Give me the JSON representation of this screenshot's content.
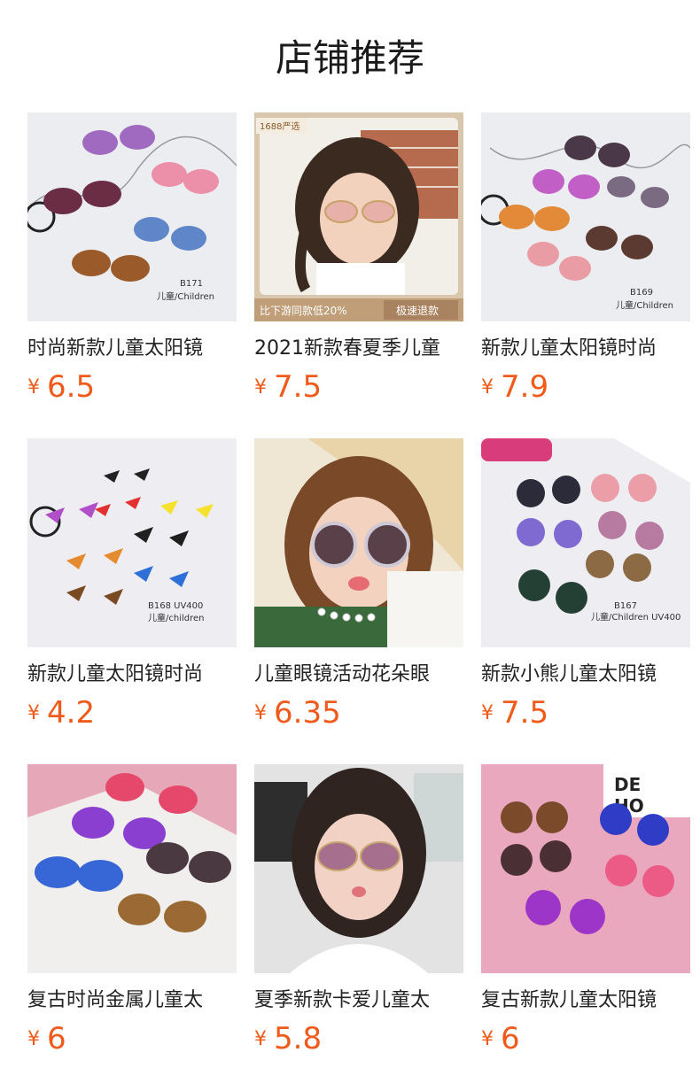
{
  "title": "店铺推荐",
  "currency": "¥",
  "products": [
    {
      "name": "时尚新款儿童太阳镜",
      "price": "6.5",
      "image_label": "B171",
      "image_sub": "儿童/Children",
      "bg": "#ecedf0"
    },
    {
      "name": "2021新款春夏季儿童",
      "price": "7.5",
      "badge_top": "1688严选",
      "banner_left": "比下游同款低20%",
      "banner_right": "极速退款",
      "bg": "#d9c7ad"
    },
    {
      "name": "新款儿童太阳镜时尚",
      "price": "7.9",
      "image_label": "B169",
      "image_sub": "儿童/Children",
      "bg": "#ecedf0"
    },
    {
      "name": "新款儿童太阳镜时尚",
      "price": "4.2",
      "image_label": "B168  UV400",
      "image_sub": "儿童/children",
      "bg": "#eeeef2"
    },
    {
      "name": "儿童眼镜活动花朵眼",
      "price": "6.35",
      "bg": "#efe6d4"
    },
    {
      "name": "新款小熊儿童太阳镜",
      "price": "7.5",
      "image_label": "B167",
      "image_sub": "儿童/Children UV400",
      "bg": "#eeeef2"
    },
    {
      "name": "复古时尚金属儿童太",
      "price": "6",
      "bg": "#e6a7b8"
    },
    {
      "name": "夏季新款卡爱儿童太",
      "price": "5.8",
      "bg": "#e3e3e3"
    },
    {
      "name": "复古新款儿童太阳镜",
      "price": "6",
      "bg": "#e9a8bd"
    }
  ]
}
